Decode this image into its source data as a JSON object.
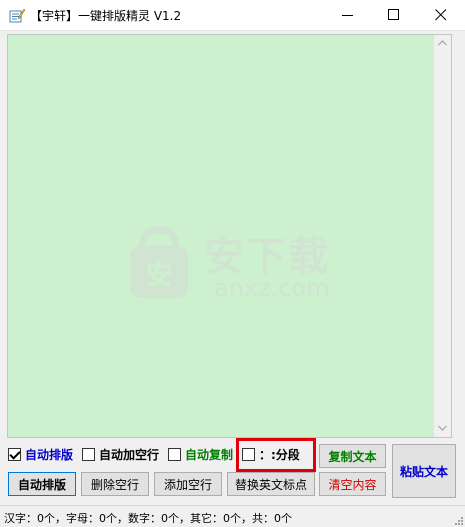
{
  "window": {
    "title": "【宇轩】一键排版精灵 V1.2",
    "controls": {
      "minimize": "minimize",
      "maximize": "maximize",
      "close": "close"
    }
  },
  "editor": {
    "background": "#cdf0cf",
    "text": "",
    "watermark": {
      "title": "安下载",
      "subtitle": "anxz.com"
    }
  },
  "options": {
    "auto_layout": {
      "label": "自动排版",
      "checked": true,
      "color": "#0000cc"
    },
    "auto_blank_line": {
      "label": "自动加空行",
      "checked": false,
      "color": "#000000"
    },
    "auto_copy": {
      "label": "自动复制",
      "checked": false,
      "color": "#008000"
    },
    "split_paragraph": {
      "label": "：:分段",
      "checked": false,
      "color": "#000000"
    }
  },
  "buttons": {
    "copy_text": {
      "label": "复制文本",
      "color": "#008000"
    },
    "paste_text": {
      "label": "粘贴文本",
      "color": "#0000cc"
    },
    "auto_layout": {
      "label": "自动排版"
    },
    "delete_blank_lines": {
      "label": "删除空行"
    },
    "add_blank_lines": {
      "label": "添加空行"
    },
    "replace_punctuation": {
      "label": "替换英文标点"
    },
    "clear_content": {
      "label": "清空内容",
      "color": "#cc0000"
    }
  },
  "status": {
    "text": "汉字：0个，字母：0个，数字：0个，其它：0个，共：0个"
  },
  "accent_highlight": "#e0000a"
}
